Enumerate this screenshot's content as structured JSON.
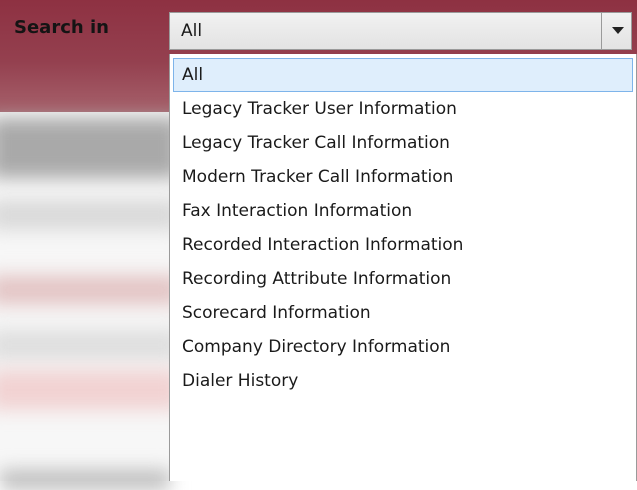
{
  "search": {
    "label": "Search in",
    "selected_value": "All",
    "options": [
      "All",
      "Legacy Tracker User Information",
      "Legacy Tracker Call Information",
      "Modern Tracker Call Information",
      "Fax Interaction Information",
      "Recorded Interaction Information",
      "Recording Attribute Information",
      "Scorecard Information",
      "Company Directory Information",
      "Dialer History"
    ]
  },
  "colors": {
    "header_bg": "#8e3142",
    "highlight_bg": "#dfeefc",
    "highlight_border": "#7eb4ea"
  },
  "icons": {
    "dropdown_arrow": "chevron-down-icon"
  }
}
